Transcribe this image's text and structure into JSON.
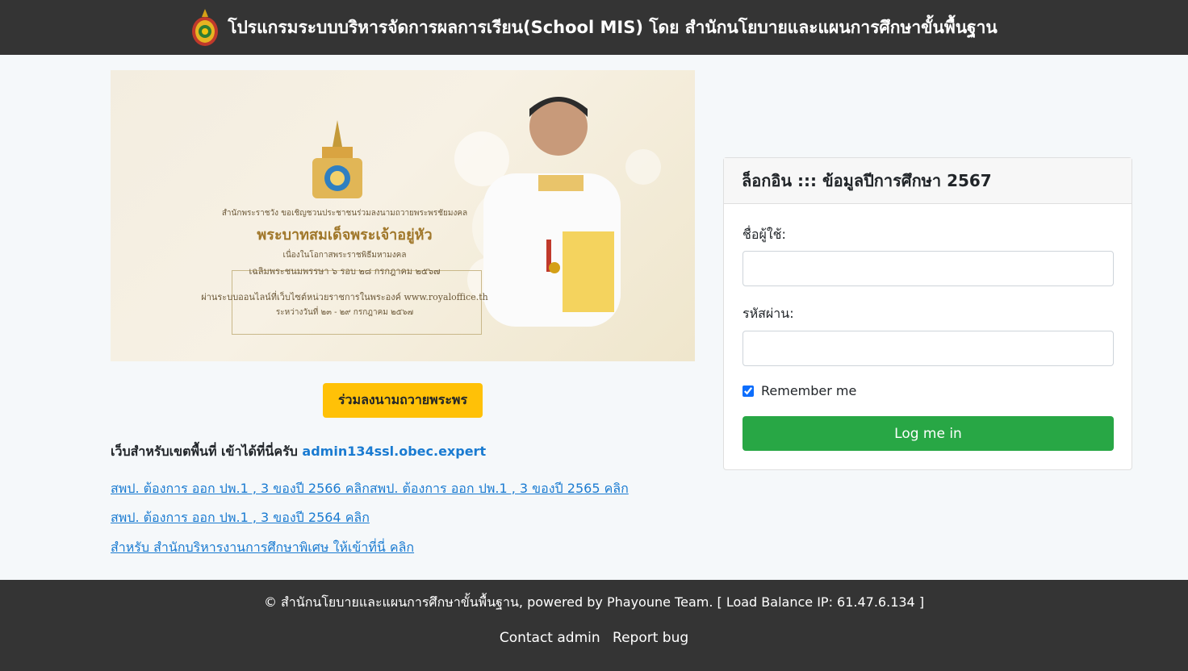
{
  "header": {
    "title": "โปรแกรมระบบบริหารจัดการผลการเรียน(School MIS) โดย สำนักนโยบายและแผนการศึกษาขั้นพื้นฐาน"
  },
  "banner": {
    "line1": "สำนักพระราชวัง ขอเชิญชวนประชาชนร่วมลงนามถวายพระพรชัยมงคล",
    "line2": "พระบาทสมเด็จพระเจ้าอยู่หัว",
    "line3": "เนื่องในโอกาสพระราชพิธีมหามงคล",
    "line4": "เฉลิมพระชนมพรรษา ๖ รอบ ๒๘ กรกฎาคม ๒๕๖๗",
    "line5": "ผ่านระบบออนไลน์ที่เว็บไซต์หน่วยราชการในพระองค์ www.royaloffice.th",
    "line6": "ระหว่างวันที่ ๒๓ - ๒๙ กรกฎาคม ๒๕๖๗"
  },
  "sign_button": "ร่วมลงนามถวายพระพร",
  "region": {
    "text": "เว็บสำหรับเขตพื้นที่ เข้าได้ที่นี่ครับ",
    "link": "admin134ssl.obec.expert"
  },
  "links": [
    "สพป. ต้องการ ออก ปพ.1 , 3 ของปี 2566 คลิกสพป. ต้องการ ออก ปพ.1 , 3 ของปี 2565 คลิก",
    "สพป. ต้องการ ออก ปพ.1 , 3 ของปี 2564 คลิก",
    "สำหรับ สำนักบริหารงานการศึกษาพิเศษ ให้เข้าที่นี่ คลิก"
  ],
  "login": {
    "header": "ล็อกอิน ::: ข้อมูลปีการศึกษา 2567",
    "username_label": "ชื่อผู้ใช้:",
    "username_value": "",
    "password_label": "รหัสผ่าน:",
    "password_value": "",
    "remember_label": "Remember me",
    "remember_checked": true,
    "submit_label": "Log me in"
  },
  "footer": {
    "copyright": "© สำนักนโยบายและแผนการศึกษาขั้นพื้นฐาน, powered by Phayoune Team. [ Load Balance IP: 61.47.6.134 ]",
    "contact": "Contact admin",
    "report": "Report bug"
  },
  "colors": {
    "topbar": "#343434",
    "accent_yellow": "#ffc107",
    "login_green": "#28a745",
    "link_blue": "#1a7bd1"
  }
}
